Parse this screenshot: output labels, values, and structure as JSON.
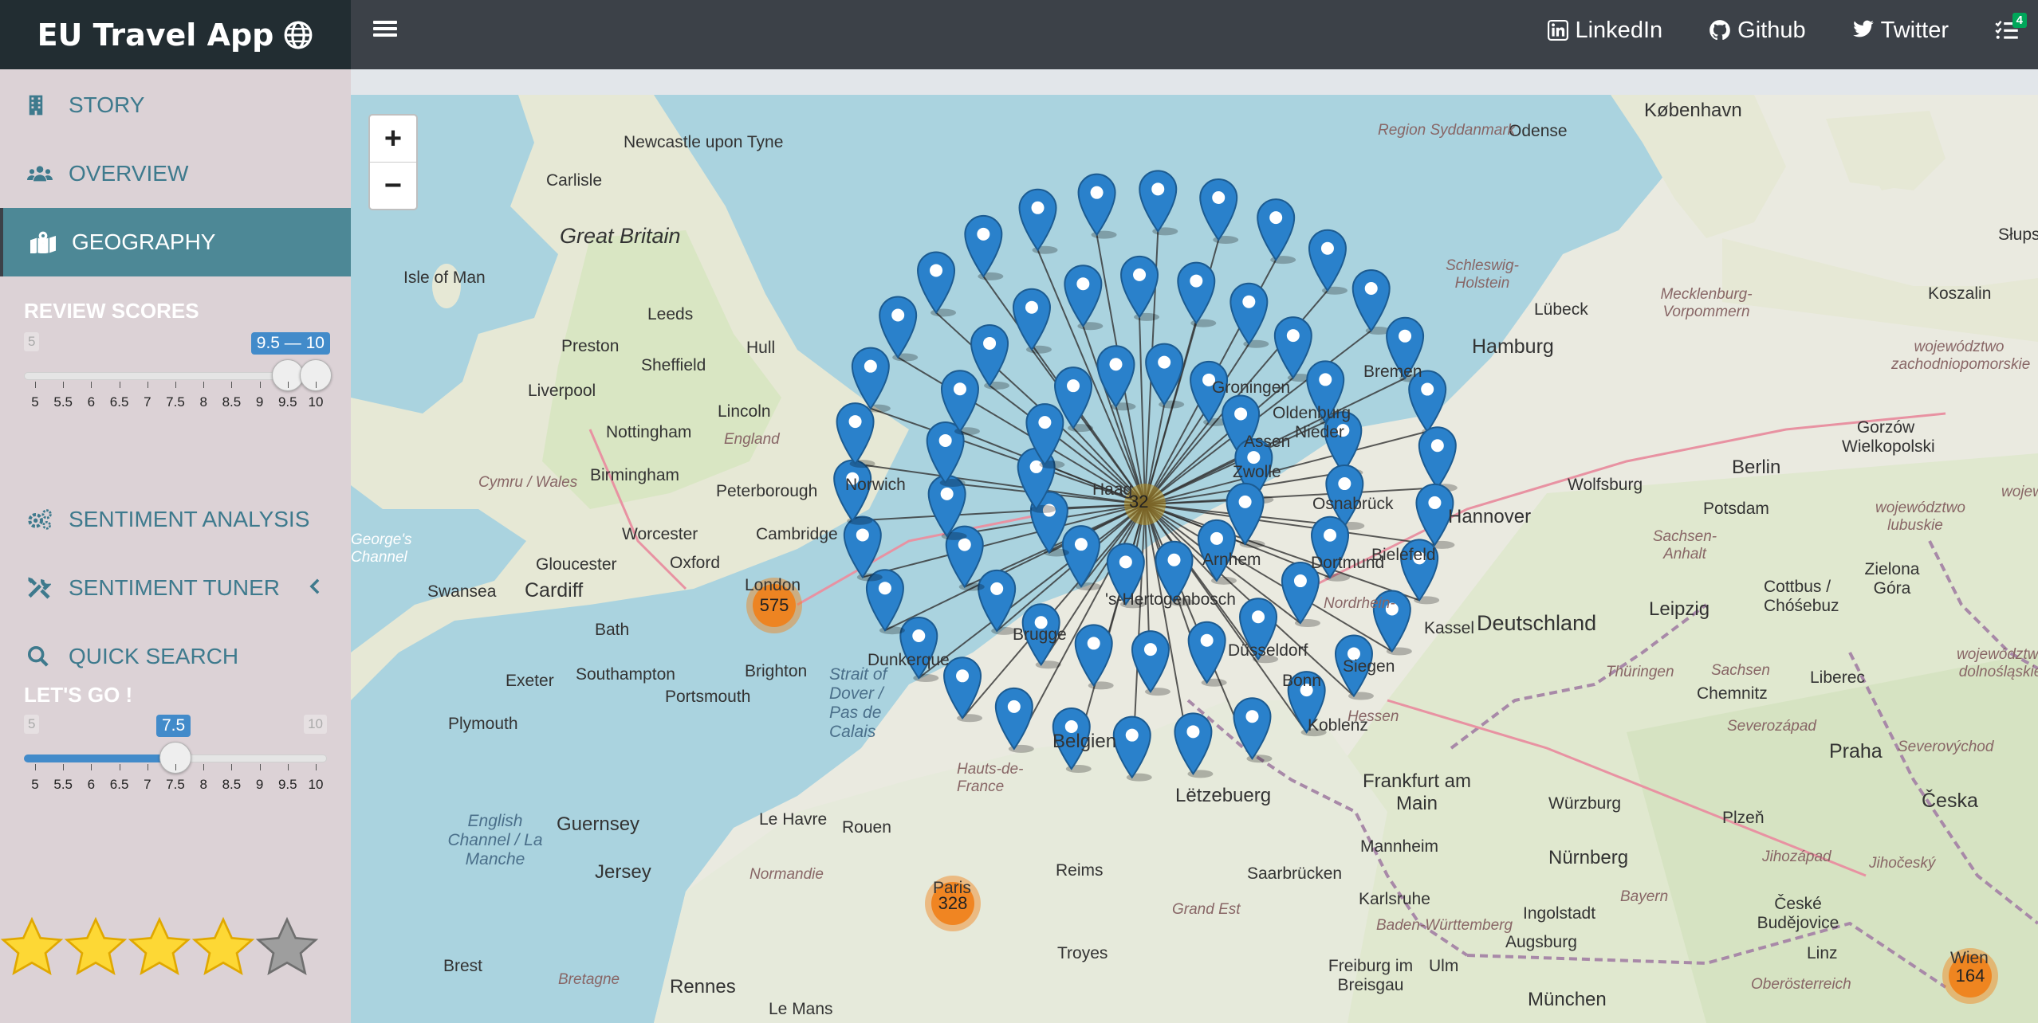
{
  "app": {
    "title": "EU Travel App"
  },
  "topnav": {
    "links": [
      {
        "label": "LinkedIn"
      },
      {
        "label": "Github"
      },
      {
        "label": "Twitter"
      }
    ],
    "tasks_count": "4"
  },
  "sidebar": {
    "items": [
      {
        "label": "STORY"
      },
      {
        "label": "OVERVIEW"
      },
      {
        "label": "GEOGRAPHY"
      },
      {
        "label": "SENTIMENT ANALYSIS"
      },
      {
        "label": "SENTIMENT TUNER"
      },
      {
        "label": "QUICK SEARCH"
      }
    ]
  },
  "review_scores": {
    "title": "REVIEW SCORES",
    "min_label": "5",
    "max_label": "10",
    "value_label": "9.5 — 10",
    "range": [
      9.5,
      10
    ],
    "ticks": [
      "5",
      "5.5",
      "6",
      "6.5",
      "7",
      "7.5",
      "8",
      "8.5",
      "9",
      "9.5",
      "10"
    ]
  },
  "lets_go": {
    "title": "LET'S GO !",
    "min_label": "5",
    "max_label": "10",
    "value_label": "7.5",
    "value": 7.5,
    "ticks": [
      "5",
      "5.5",
      "6",
      "6.5",
      "7",
      "7.5",
      "8",
      "8.5",
      "9",
      "9.5",
      "10"
    ]
  },
  "rating": {
    "filled": 4,
    "total": 5
  },
  "map": {
    "zoom_in": "+",
    "zoom_out": "−",
    "clusters": [
      {
        "count": "575"
      },
      {
        "count": "328"
      },
      {
        "count": "164"
      }
    ],
    "spider_center": "32",
    "labels": {
      "newcastle": "Newcastle upon Tyne",
      "carlisle": "Carlisle",
      "great_britain": "Great Britain",
      "isle_of_man": "Isle of Man",
      "leeds": "Leeds",
      "preston": "Preston",
      "hull": "Hull",
      "sheffield": "Sheffield",
      "liverpool": "Liverpool",
      "nottingham": "Nottingham",
      "lincoln": "Lincoln",
      "england": "England",
      "birmingham": "Birmingham",
      "cymru": "Cymru / Wales",
      "peterborough": "Peterborough",
      "worcester": "Worcester",
      "cambridge": "Cambridge",
      "gloucester": "Gloucester",
      "oxford": "Oxford",
      "swansea": "Swansea",
      "cardiff": "Cardiff",
      "london": "London",
      "bath": "Bath",
      "brighton": "Brighton",
      "exeter": "Exeter",
      "southampton": "Southampton",
      "portsmouth": "Portsmouth",
      "plymouth": "Plymouth",
      "dunkerque": "Dunkerque",
      "strait": "Strait of Dover / Pas de Calais",
      "english_channel": "English Channel / La Manche",
      "guernsey": "Guernsey",
      "jersey": "Jersey",
      "le_havre": "Le Havre",
      "rouen": "Rouen",
      "normandie": "Normandie",
      "hauts_de_france": "Hauts-de-France",
      "paris": "Paris",
      "reims": "Reims",
      "troyes": "Troyes",
      "brest": "Brest",
      "bretagne": "Bretagne",
      "rennes": "Rennes",
      "le_mans": "Le Mans",
      "letzebuerg": "Lëtzebuerg",
      "saarbrucken": "Saarbrücken",
      "grand_est": "Grand Est",
      "freiburg": "Freiburg im Breisgau",
      "karlsruhe": "Karlsruhe",
      "baden": "Baden-Württemberg",
      "mannheim": "Mannheim",
      "frankfurt": "Frankfurt am Main",
      "hessen": "Hessen",
      "koblenz": "Koblenz",
      "siegen": "Siegen",
      "bonn": "Bonn",
      "bielefeld": "Bielefeld",
      "kassel": "Kassel",
      "deutschland": "Deutschland",
      "wurzburg": "Würzburg",
      "nurnberg": "Nürnberg",
      "bayern": "Bayern",
      "ingolstadt": "Ingolstadt",
      "augsburg": "Augsburg",
      "ulm": "Ulm",
      "munchen": "München",
      "oberosterreich": "Oberösterreich",
      "linz": "Linz",
      "wien": "Wien",
      "ceske": "České Budějovice",
      "jihoceske": "Jihočeský",
      "plzen": "Plzeň",
      "praha": "Praha",
      "ceska": "Česka",
      "chemnitz": "Chemnitz",
      "sachsen": "Sachsen",
      "liberec": "Liberec",
      "leipzig": "Leipzig",
      "thuringen": "Thüringen",
      "cottbus": "Cottbus / Chóśebuz",
      "zielona": "Zielona Góra",
      "sachsen_anhalt": "Sachsen-Anhalt",
      "potsdam": "Potsdam",
      "berlin": "Berlin",
      "wolfsburg": "Wolfsburg",
      "hannover": "Hannover",
      "hamburg": "Hamburg",
      "lubeck": "Lübeck",
      "schleswig": "Schleswig-Holstein",
      "mecklenburg": "Mecklenburg-Vorpommern",
      "kobenhavn": "København",
      "odense": "Odense",
      "region_syddanmark": "Region Syddanmark",
      "koszalin": "Koszalin",
      "zachodnio": "województwo zachodniopomorskie",
      "gorzow": "Gorzów Wielkopolski",
      "lubuskie": "województwo lubuskie",
      "slups": "Słups",
      "dolnoslaskie": "województwo dolnośląskie",
      "severozapad": "Severozápad",
      "severovychod": "Severovýchod",
      "jihozapad": "Jihozápad",
      "wojew": "wojew",
      "georges_channel": "George's Channel",
      "bremen": "Bremen",
      "neder": "Nieder",
      "brugge": "Brugge",
      "belgien": "Belgien",
      "hertogenbosch": "'s-Hertogenbosch",
      "groningen": "Groningen",
      "oldenburg": "Oldenburg",
      "assen": "Assen",
      "zwolle": "Zwolle",
      "haag": "Haag",
      "arnhem": "Arnhem",
      "osnabruck": "Osnabrück",
      "dusseldorf": "Düsseldorf",
      "nordrhein": "Nordrhein-",
      "dortmund": "Dortmund",
      "norwich": "Norwich"
    }
  },
  "colors": {
    "accent": "#4d8896",
    "brand_bg": "#222d32",
    "topbar": "#3c4148",
    "sidebar": "#dcd2d6",
    "slider": "#428bca",
    "marker": "#2a81cb",
    "cluster": "#f18017"
  }
}
